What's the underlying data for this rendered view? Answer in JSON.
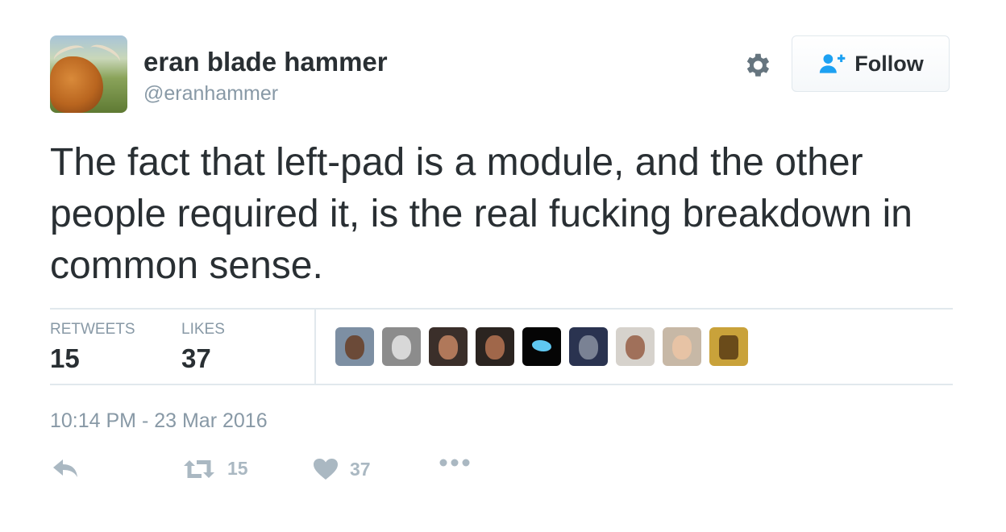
{
  "user": {
    "display_name": "eran blade hammer",
    "handle": "@eranhammer",
    "avatar_icon": "highland-cow-avatar"
  },
  "header": {
    "settings_icon": "gear-icon",
    "follow_label": "Follow",
    "follow_icon": "add-user-icon"
  },
  "tweet": {
    "text": "The fact that left-pad is a module, and the other people required it, is the real fucking breakdown in common sense."
  },
  "stats": {
    "retweets_label": "RETWEETS",
    "retweets_value": "15",
    "likes_label": "LIKES",
    "likes_value": "37"
  },
  "likers": [
    "liker-avatar-1",
    "liker-avatar-2",
    "liker-avatar-3",
    "liker-avatar-4",
    "liker-avatar-5",
    "liker-avatar-6",
    "liker-avatar-7",
    "liker-avatar-8",
    "liker-avatar-9"
  ],
  "timestamp": "10:14 PM - 23 Mar 2016",
  "actions": {
    "reply_icon": "reply-icon",
    "retweet_icon": "retweet-icon",
    "retweet_count": "15",
    "like_icon": "heart-icon",
    "like_count": "37",
    "more_icon": "more-dots-icon"
  },
  "colors": {
    "text": "#292f33",
    "muted": "#8899a6",
    "action": "#aab8c2",
    "follow_icon": "#1da1f2",
    "divider": "#e1e8ed"
  }
}
